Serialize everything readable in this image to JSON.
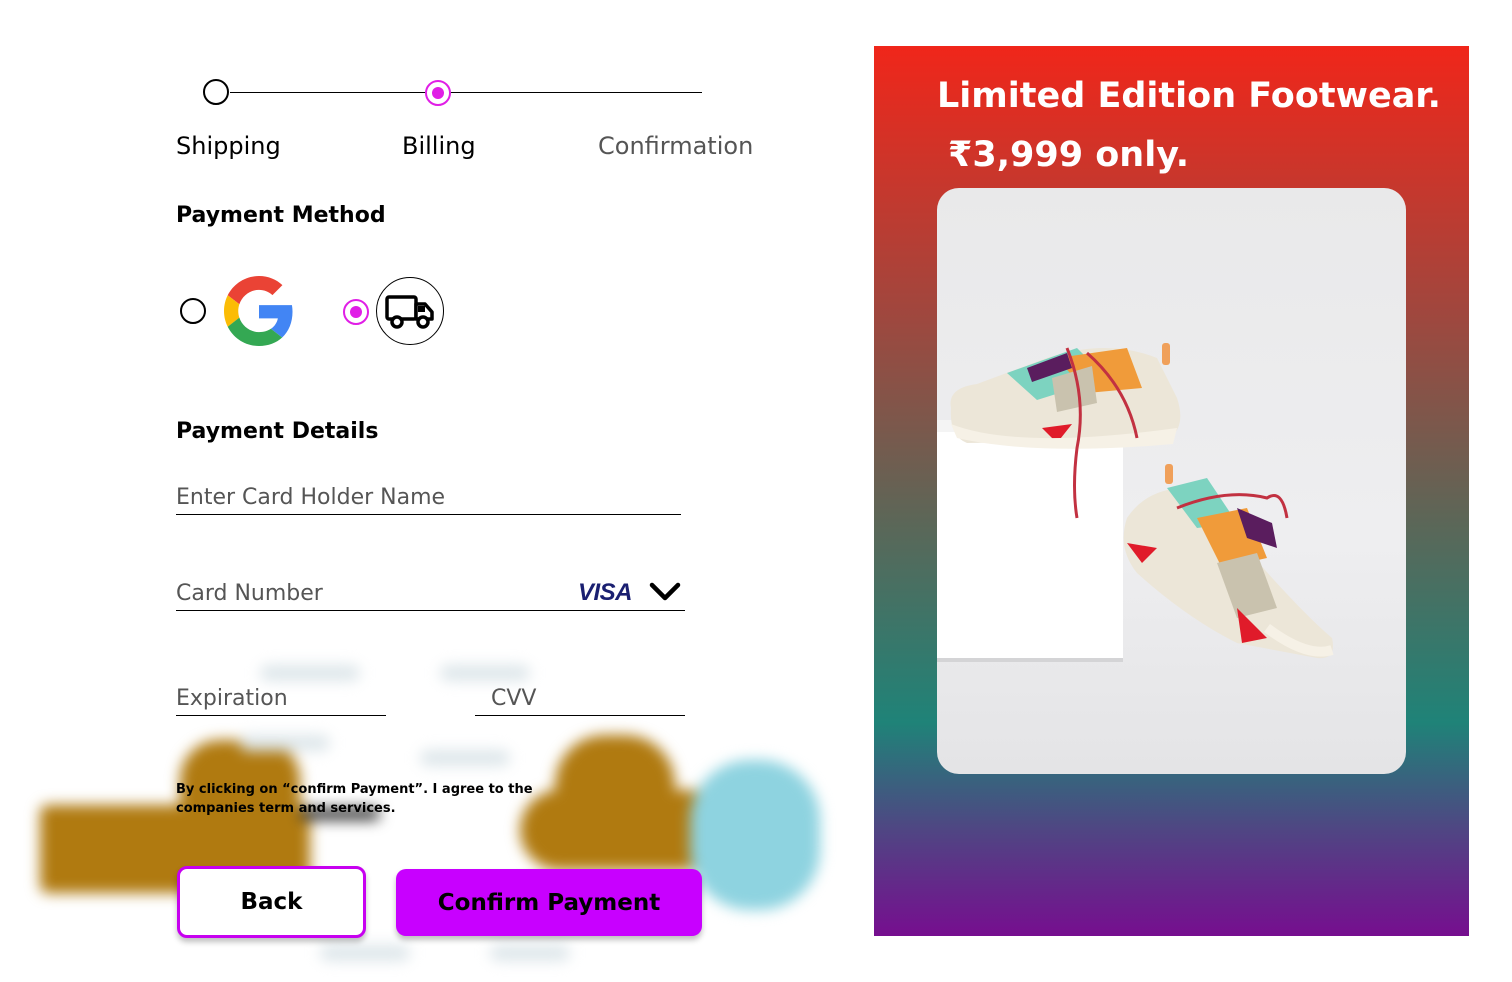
{
  "stepper": {
    "steps": [
      {
        "label": "Shipping",
        "state": "done"
      },
      {
        "label": "Billing",
        "state": "active"
      },
      {
        "label": "Confirmation",
        "state": "pending"
      }
    ]
  },
  "payment_method": {
    "heading": "Payment Method",
    "options": [
      {
        "icon": "google-icon",
        "selected": false
      },
      {
        "icon": "truck-icon",
        "selected": true
      }
    ]
  },
  "payment_details": {
    "heading": "Payment Details",
    "card_holder_placeholder": "Enter Card Holder Name",
    "card_number_placeholder": "Card Number",
    "card_brand": "VISA",
    "expiration_placeholder": "Expiration",
    "cvv_placeholder": "CVV"
  },
  "terms_text": "By clicking on “confirm Payment”. I agree to the companies term and services.",
  "buttons": {
    "back": "Back",
    "confirm": "Confirm Payment"
  },
  "promo": {
    "title": "Limited Edition Footwear.",
    "price": "₹3,999 only."
  },
  "colors": {
    "accent": "#c800ff",
    "radio_active": "#e01ee6",
    "promo_top": "#f0261a",
    "promo_bottom": "#760e8f"
  }
}
